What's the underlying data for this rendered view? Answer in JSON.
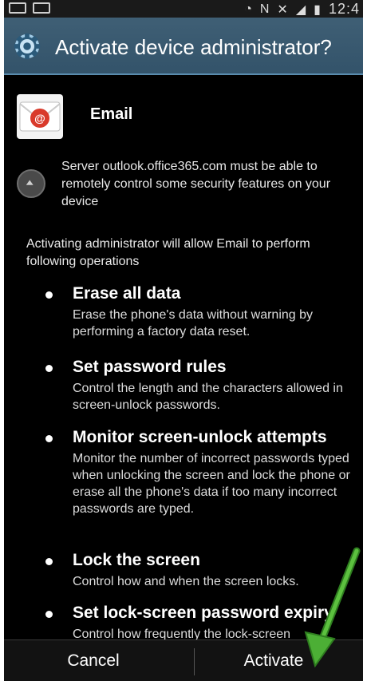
{
  "status_bar": {
    "time": "12:4"
  },
  "dialog": {
    "title": "Activate device administrator?",
    "app_name": "Email",
    "server_message": "Server outlook.office365.com must be able to remotely control some security features on your device",
    "intro": "Activating administrator will allow Email to perform following operations",
    "permissions": [
      {
        "title": "Erase all data",
        "description": "Erase the phone's data without warning by performing a factory data reset."
      },
      {
        "title": "Set password rules",
        "description": "Control the length and the characters allowed in screen-unlock passwords."
      },
      {
        "title": "Monitor screen-unlock attempts",
        "description": "Monitor the number of incorrect passwords typed when unlocking the screen and lock the phone or erase all the phone's data if too many incorrect passwords are typed."
      },
      {
        "title": "Lock the screen",
        "description": "Control how and when the screen locks."
      },
      {
        "title": "Set lock-screen password expiry",
        "description": "Control how frequently the lock-screen"
      }
    ]
  },
  "buttons": {
    "cancel": "Cancel",
    "activate": "Activate"
  },
  "colors": {
    "title_bar": "#3f5f75",
    "accent_line": "#5a8cae",
    "arrow": "#4caf35",
    "email_red": "#d93a2b"
  },
  "icons": {
    "title": "gear-icon",
    "app": "email-envelope-icon",
    "expand": "chevron-up-icon",
    "annotation": "green-arrow"
  }
}
